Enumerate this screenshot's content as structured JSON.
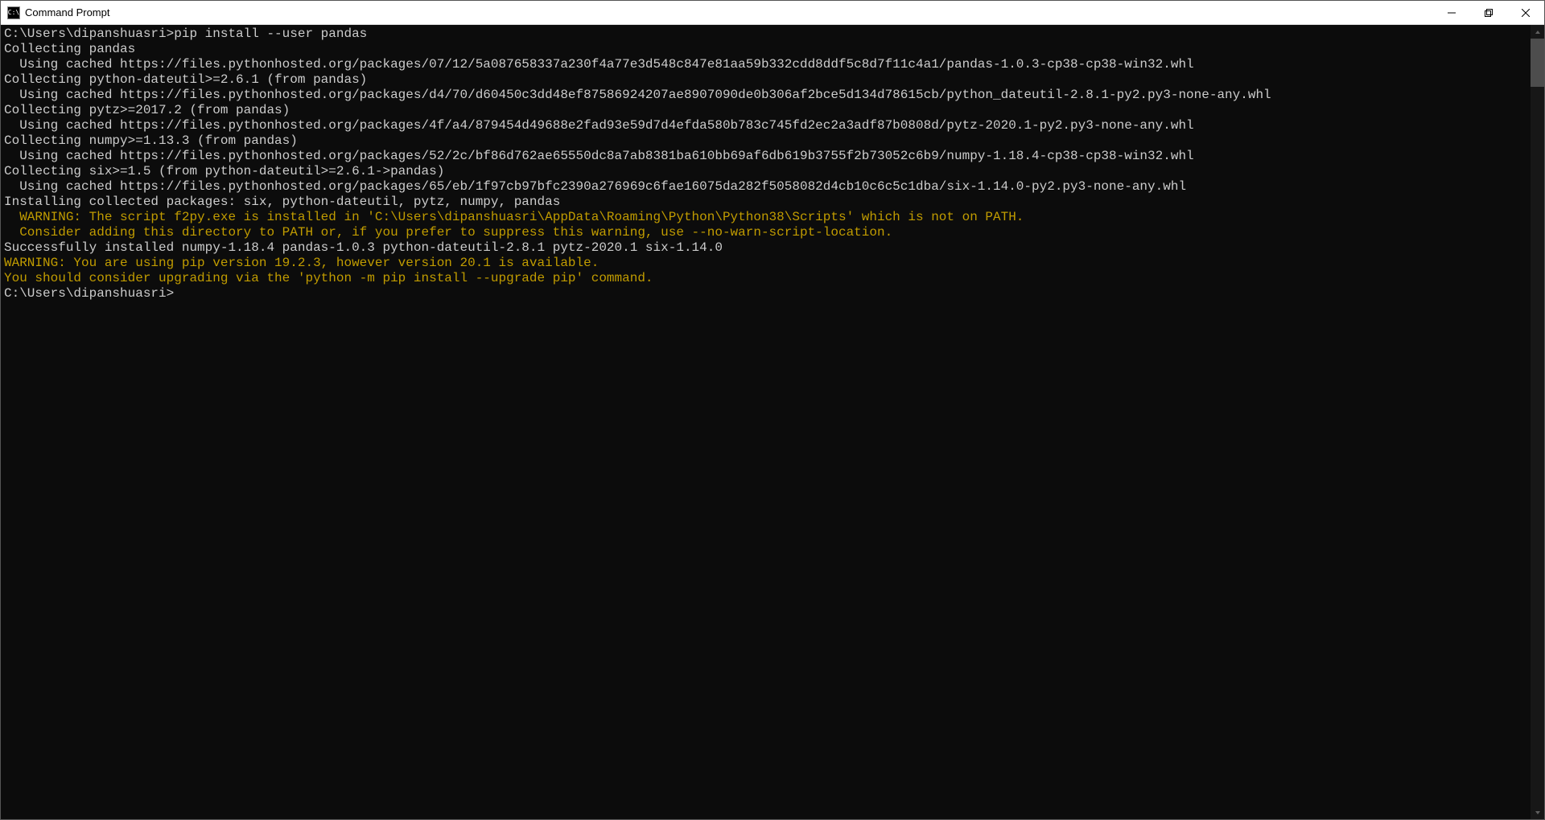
{
  "window": {
    "icon_text": "C:\\",
    "title": "Command Prompt"
  },
  "terminal": {
    "prompt1": "C:\\Users\\dipanshuasri>",
    "command1": "pip install --user pandas",
    "lines": [
      "Collecting pandas",
      "  Using cached https://files.pythonhosted.org/packages/07/12/5a087658337a230f4a77e3d548c847e81aa59b332cdd8ddf5c8d7f11c4a1/pandas-1.0.3-cp38-cp38-win32.whl",
      "Collecting python-dateutil>=2.6.1 (from pandas)",
      "  Using cached https://files.pythonhosted.org/packages/d4/70/d60450c3dd48ef87586924207ae8907090de0b306af2bce5d134d78615cb/python_dateutil-2.8.1-py2.py3-none-any.whl",
      "Collecting pytz>=2017.2 (from pandas)",
      "  Using cached https://files.pythonhosted.org/packages/4f/a4/879454d49688e2fad93e59d7d4efda580b783c745fd2ec2a3adf87b0808d/pytz-2020.1-py2.py3-none-any.whl",
      "Collecting numpy>=1.13.3 (from pandas)",
      "  Using cached https://files.pythonhosted.org/packages/52/2c/bf86d762ae65550dc8a7ab8381ba610bb69af6db619b3755f2b73052c6b9/numpy-1.18.4-cp38-cp38-win32.whl",
      "Collecting six>=1.5 (from python-dateutil>=2.6.1->pandas)",
      "  Using cached https://files.pythonhosted.org/packages/65/eb/1f97cb97bfc2390a276969c6fae16075da282f5058082d4cb10c6c5c1dba/six-1.14.0-py2.py3-none-any.whl",
      "Installing collected packages: six, python-dateutil, pytz, numpy, pandas"
    ],
    "warn_lines": [
      "  WARNING: The script f2py.exe is installed in 'C:\\Users\\dipanshuasri\\AppData\\Roaming\\Python\\Python38\\Scripts' which is not on PATH.",
      "  Consider adding this directory to PATH or, if you prefer to suppress this warning, use --no-warn-script-location."
    ],
    "success_line": "Successfully installed numpy-1.18.4 pandas-1.0.3 python-dateutil-2.8.1 pytz-2020.1 six-1.14.0",
    "warn_lines2": [
      "WARNING: You are using pip version 19.2.3, however version 20.1 is available.",
      "You should consider upgrading via the 'python -m pip install --upgrade pip' command."
    ],
    "prompt2": "C:\\Users\\dipanshuasri>"
  }
}
